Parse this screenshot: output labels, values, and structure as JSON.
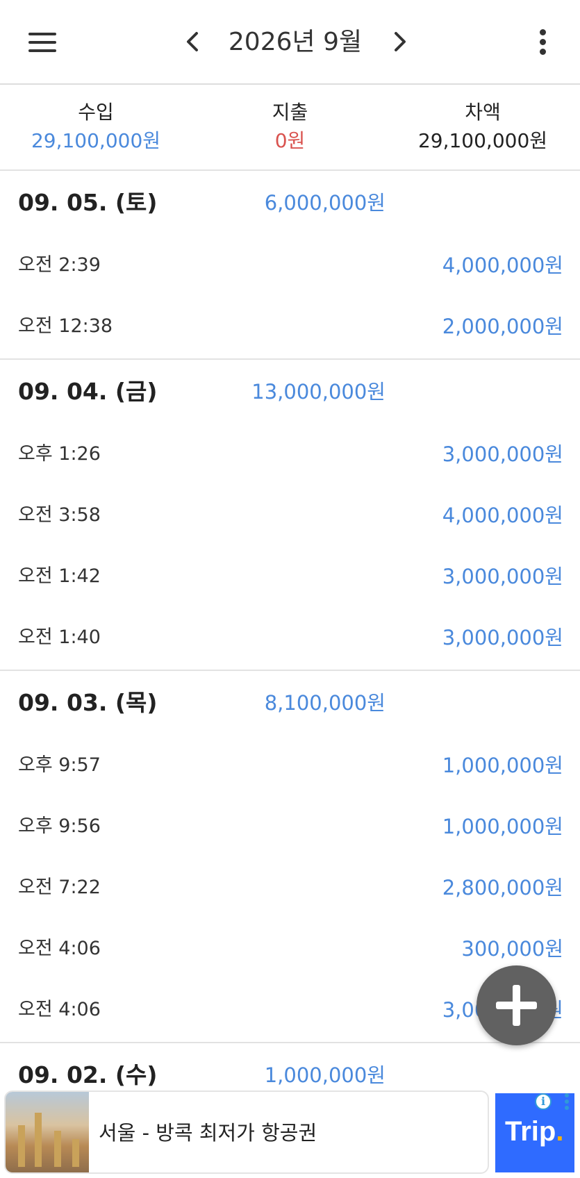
{
  "header": {
    "title": "2026년 9월",
    "menu_icon": "hamburger-menu-icon",
    "prev_icon": "chevron-left-icon",
    "next_icon": "chevron-right-icon",
    "more_icon": "vertical-dots-icon"
  },
  "summary": {
    "income_label": "수입",
    "income_value": "29,100,000원",
    "expense_label": "지출",
    "expense_value": "0원",
    "balance_label": "차액",
    "balance_value": "29,100,000원"
  },
  "days": [
    {
      "date": "09. 05. (토)",
      "total": "6,000,000원",
      "transactions": [
        {
          "time": "오전 2:39",
          "amount": "4,000,000원"
        },
        {
          "time": "오전 12:38",
          "amount": "2,000,000원"
        }
      ]
    },
    {
      "date": "09. 04. (금)",
      "total": "13,000,000원",
      "transactions": [
        {
          "time": "오후 1:26",
          "amount": "3,000,000원"
        },
        {
          "time": "오전 3:58",
          "amount": "4,000,000원"
        },
        {
          "time": "오전 1:42",
          "amount": "3,000,000원"
        },
        {
          "time": "오전 1:40",
          "amount": "3,000,000원"
        }
      ]
    },
    {
      "date": "09. 03. (목)",
      "total": "8,100,000원",
      "transactions": [
        {
          "time": "오후 9:57",
          "amount": "1,000,000원"
        },
        {
          "time": "오후 9:56",
          "amount": "1,000,000원"
        },
        {
          "time": "오전 7:22",
          "amount": "2,800,000원"
        },
        {
          "time": "오전 4:06",
          "amount": "300,000원"
        },
        {
          "time": "오전 4:06",
          "amount": "3,000,000원"
        }
      ]
    },
    {
      "date": "09. 02. (수)",
      "total": "1,000,000원",
      "transactions": []
    }
  ],
  "fab": {
    "icon": "plus-icon"
  },
  "ad": {
    "text": "서울 - 방콕 최저가 항공권",
    "logo_text": "Trip",
    "logo_dot": ".",
    "info_icon": "info-icon",
    "more_icon": "ad-options-icon"
  },
  "colors": {
    "income": "#4a89dc",
    "expense": "#d9534f",
    "fab": "#616161",
    "ad_logo_bg": "#2f6bff"
  }
}
